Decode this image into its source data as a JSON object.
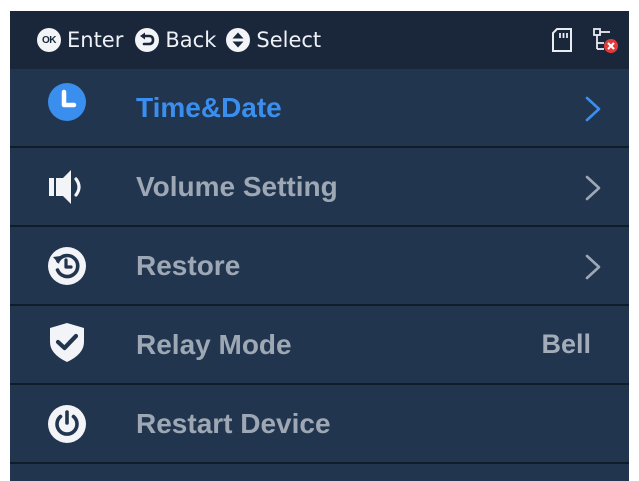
{
  "topbar": {
    "hints": [
      {
        "icon": "ok-icon",
        "label": "Enter"
      },
      {
        "icon": "back-icon",
        "label": "Back"
      },
      {
        "icon": "updown-icon",
        "label": "Select"
      }
    ],
    "ok_icon_text": "OK",
    "status_icons": [
      "sd-card-icon",
      "network-disconnected-icon"
    ]
  },
  "menu": {
    "items": [
      {
        "label": "Time&Date",
        "icon": "clock-icon",
        "active": true,
        "chevron": true
      },
      {
        "label": "Volume Setting",
        "icon": "speaker-icon",
        "active": false,
        "chevron": true
      },
      {
        "label": "Restore",
        "icon": "restore-icon",
        "active": false,
        "chevron": true
      },
      {
        "label": "Relay Mode",
        "icon": "shield-check-icon",
        "active": false,
        "value": "Bell"
      },
      {
        "label": "Restart Device",
        "icon": "power-icon",
        "active": false
      }
    ]
  },
  "colors": {
    "background": "#22354f",
    "topbar": "#1a273b",
    "divider": "#111c2b",
    "active_accent": "#3a8fee",
    "inactive_text": "#9ea8b5"
  }
}
